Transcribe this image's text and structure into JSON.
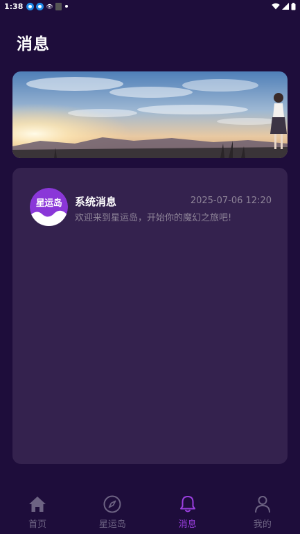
{
  "status_bar": {
    "time": "1:38"
  },
  "header": {
    "title": "消息"
  },
  "messages": [
    {
      "title": "系统消息",
      "time": "2025-07-06 12:20",
      "preview": "欢迎来到星运岛，开始你的魔幻之旅吧!",
      "avatar_text": "星运岛"
    }
  ],
  "bottom_nav": [
    {
      "label": "首页",
      "icon": "home-icon",
      "active": false
    },
    {
      "label": "星运岛",
      "icon": "compass-icon",
      "active": false
    },
    {
      "label": "消息",
      "icon": "bell-icon",
      "active": true
    },
    {
      "label": "我的",
      "icon": "user-icon",
      "active": false
    }
  ],
  "colors": {
    "background": "#1e0d3b",
    "card": "#34224e",
    "accent": "#9b3fe0",
    "inactive": "#6d6383",
    "secondary_text": "#8e8498"
  }
}
